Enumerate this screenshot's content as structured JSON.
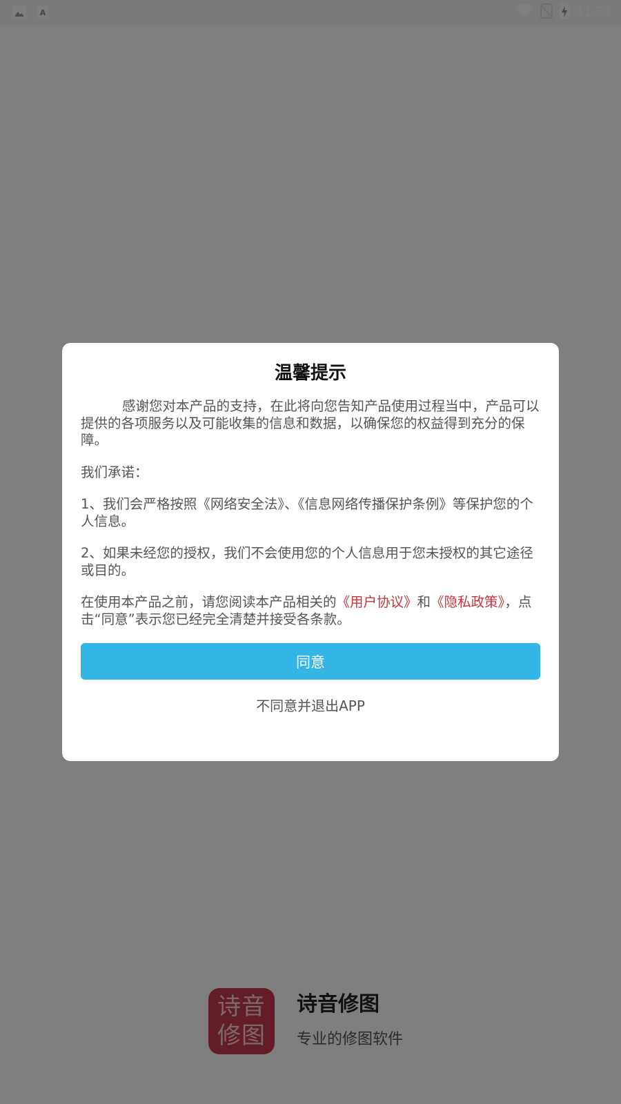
{
  "status_bar": {
    "time": "11:34",
    "left_icons": [
      "image-icon",
      "font-icon"
    ],
    "right_icons": [
      "wifi-icon",
      "no-sim-icon",
      "battery-charging-icon"
    ]
  },
  "dialog": {
    "title": "温馨提示",
    "para1": "感谢您对本产品的支持，在此将向您告知产品使用过程当中，产品可以提供的各项服务以及可能收集的信息和数据，以确保您的权益得到充分的保障。",
    "para2": "我们承诺：",
    "para3": "1、我们会严格按照《网络安全法》、《信息网络传播保护条例》等保护您的个人信息。",
    "para4": "2、如果未经您的授权，我们不会使用您的个人信息用于您未授权的其它途径或目的。",
    "para5_prefix": "在使用本产品之前，请您阅读本产品相关的",
    "user_agreement_link": "《用户协议》",
    "para5_and": "和",
    "privacy_policy_link": "《隐私政策》",
    "para5_suffix": "，点击“同意”表示您已经完全清楚并接受各条款。",
    "agree_label": "同意",
    "disagree_label": "不同意并退出APP"
  },
  "brand": {
    "logo_line1": "诗音",
    "logo_line2": "修图",
    "name": "诗音修图",
    "slogan": "专业的修图软件"
  },
  "colors": {
    "accent": "#33b5e5",
    "link": "#c8343e",
    "logo_bg": "#c63b4c"
  }
}
